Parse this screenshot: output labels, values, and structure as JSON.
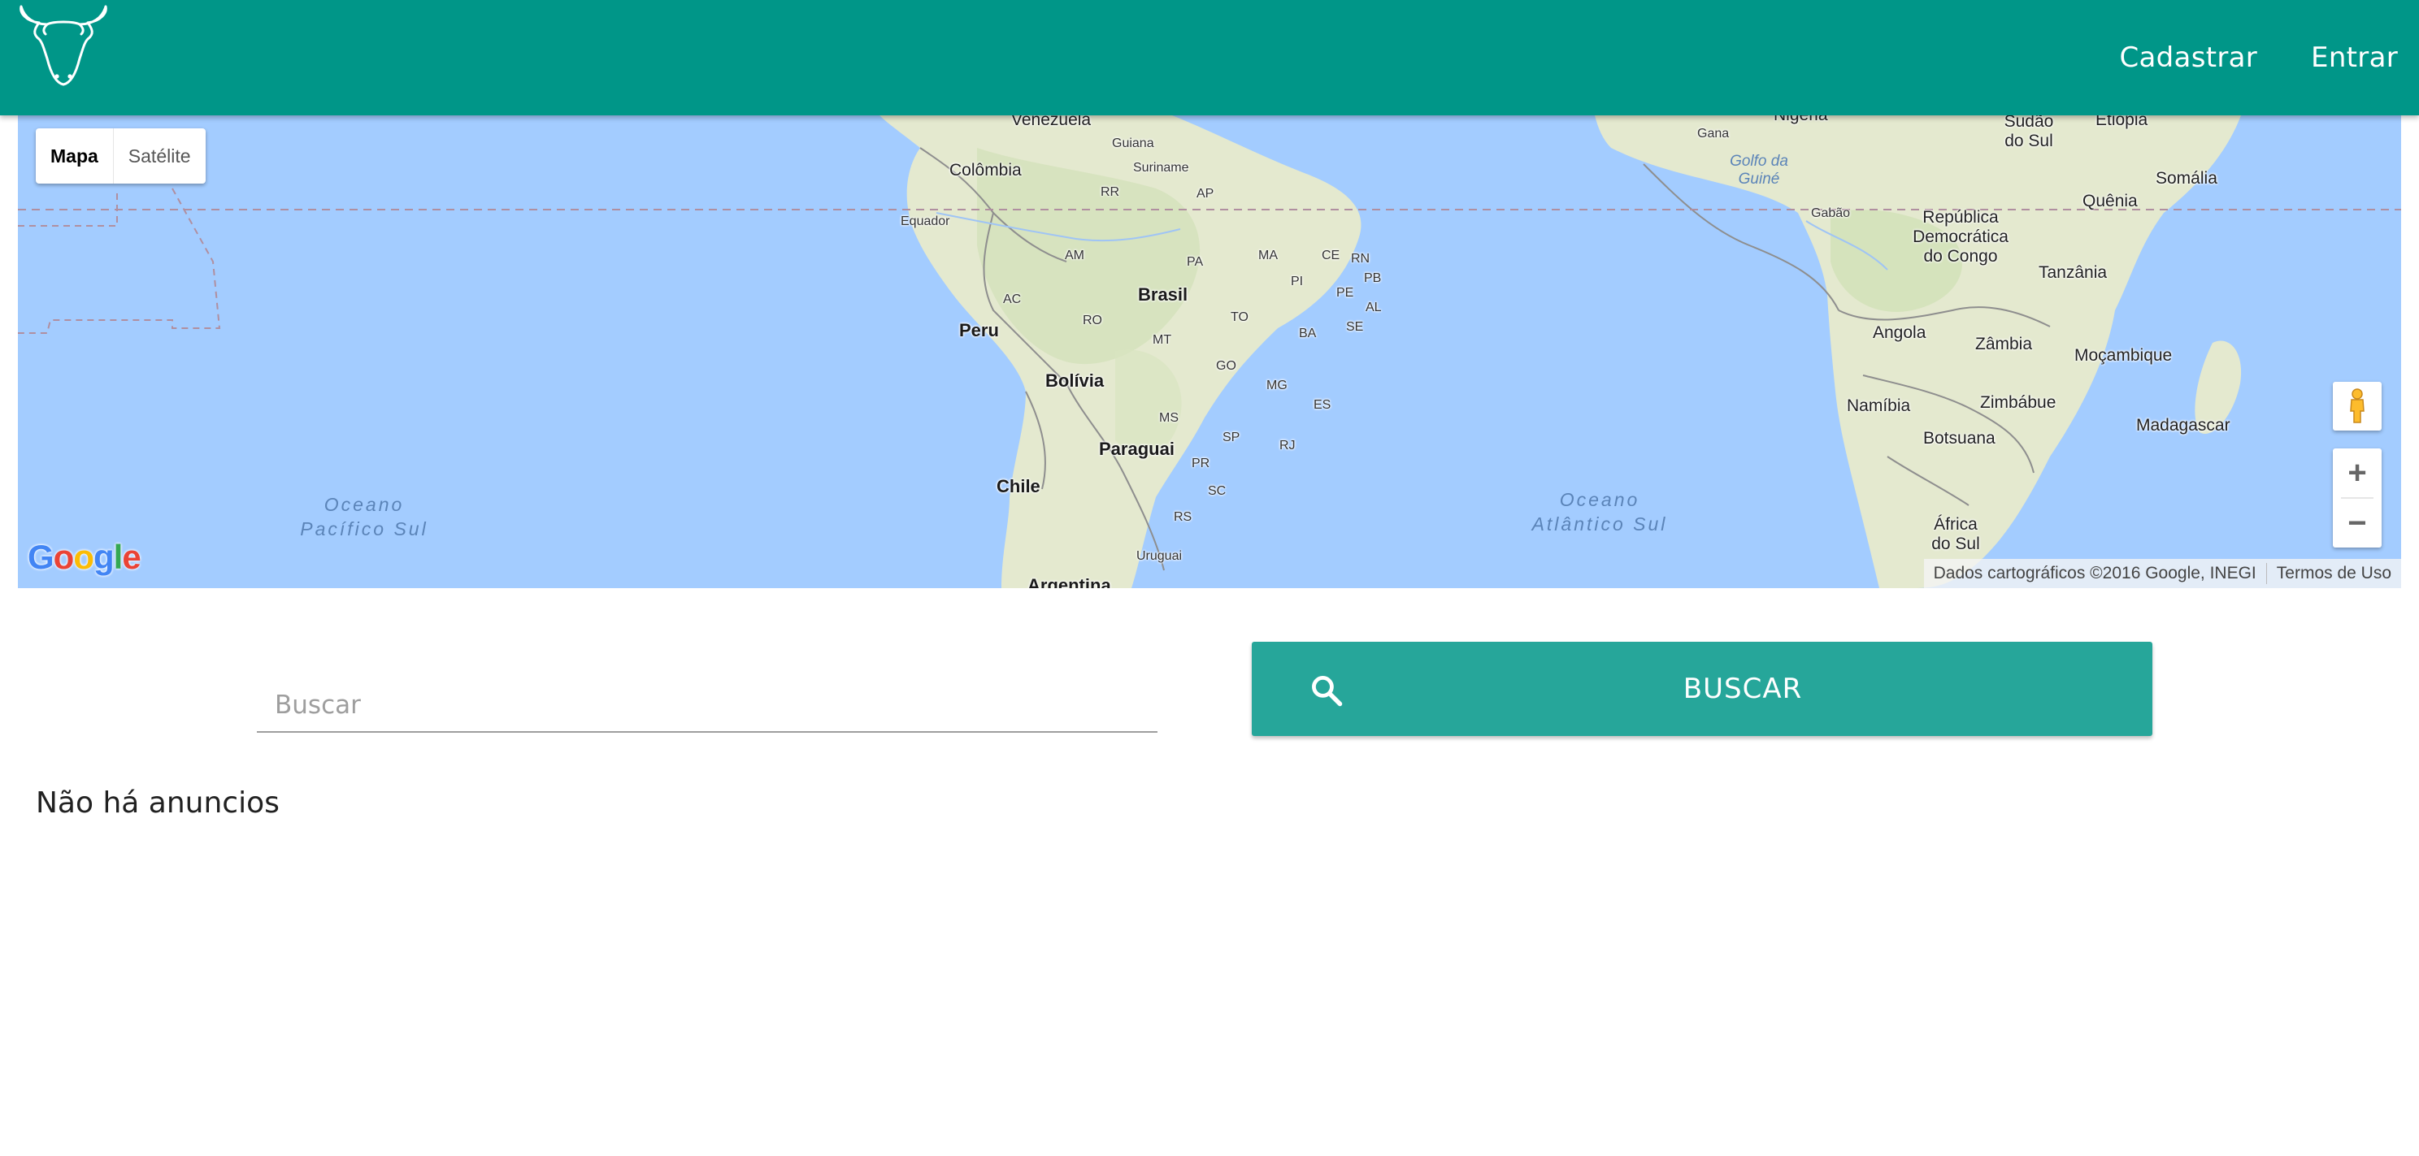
{
  "colors": {
    "navbar": "#009688",
    "button": "#26a69a",
    "water": "#a3ccff",
    "land": "#e4e9cf"
  },
  "header": {
    "logo_icon": "bull-head-icon",
    "links": [
      "Cadastrar",
      "Entrar"
    ]
  },
  "map": {
    "type_buttons": [
      "Mapa",
      "Satélite"
    ],
    "active_type": "Mapa",
    "zoom_in": "+",
    "zoom_out": "−",
    "pegman_icon": "pegman-icon",
    "google_logo": [
      "G",
      "o",
      "o",
      "g",
      "l",
      "e"
    ],
    "attribution": "Dados cartográficos ©2016 Google, INEGI",
    "terms": "Termos de Uso",
    "labels": {
      "venezuela": "Venezuela",
      "guiana": "Guiana",
      "suriname": "Suriname",
      "colombia": "Colômbia",
      "rr": "RR",
      "ap": "AP",
      "equador": "Equador",
      "am": "AM",
      "pa": "PA",
      "ma": "MA",
      "ce": "CE",
      "rn": "RN",
      "pb": "PB",
      "pi": "PI",
      "pe": "PE",
      "al": "AL",
      "se": "SE",
      "ac": "AC",
      "brasil": "Brasil",
      "peru": "Peru",
      "ro": "RO",
      "mt": "MT",
      "to": "TO",
      "ba": "BA",
      "go": "GO",
      "mg": "MG",
      "es": "ES",
      "bolivia": "Bolívia",
      "ms": "MS",
      "sp": "SP",
      "rj": "RJ",
      "paraguai": "Paraguai",
      "pr": "PR",
      "sc": "SC",
      "rs": "RS",
      "chile": "Chile",
      "uruguai": "Uruguai",
      "argentina": "Argentina",
      "oceano_pacifico": [
        "Oceano",
        "Pacífico Sul"
      ],
      "oceano_atlantico": [
        "Oceano",
        "Atlântico Sul"
      ],
      "nigeria": "Nigéria",
      "gana": "Gana",
      "golfo_guine": [
        "Golfo da",
        "Guiné"
      ],
      "sudao_do_sul": [
        "Sudão",
        "do Sul"
      ],
      "etiopia": "Etiópia",
      "somalia": "Somália",
      "quenia": "Quênia",
      "gabao": "Gabão",
      "rdc": [
        "República",
        "Democrática",
        "do Congo"
      ],
      "tanzania": "Tanzânia",
      "angola": "Angola",
      "zambia": "Zâmbia",
      "mocambique": "Moçambique",
      "namibia": "Namíbia",
      "zimbabue": "Zimbábue",
      "madagascar": "Madagascar",
      "botsuana": "Botsuana",
      "africa_do_sul": [
        "África",
        "do Sul"
      ]
    }
  },
  "search": {
    "placeholder": "Buscar",
    "value": "",
    "button_label": "BUSCAR",
    "button_icon": "search-icon"
  },
  "results": {
    "empty_message": "Não há anuncios"
  }
}
